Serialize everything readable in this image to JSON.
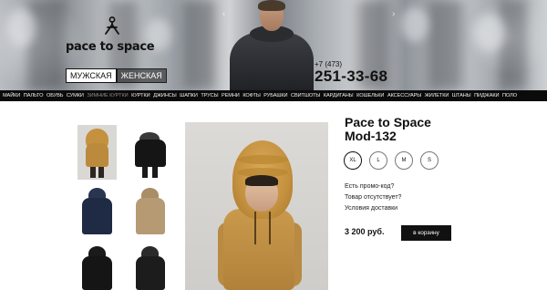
{
  "header": {
    "logo_text": "pace to space",
    "gender_tabs": [
      {
        "label": "МУЖСКАЯ",
        "active": true
      },
      {
        "label": "ЖЕНСКАЯ",
        "active": false
      }
    ],
    "phone_code": "+7 (473)",
    "phone_number": "251-33-68"
  },
  "nav": {
    "items": [
      {
        "label": "МАЙКИ",
        "active": false
      },
      {
        "label": "ПАЛЬТО",
        "active": false
      },
      {
        "label": "ОБУВЬ",
        "active": false
      },
      {
        "label": "СУМКИ",
        "active": false
      },
      {
        "label": "ЗИМНИЕ КУРТКИ",
        "active": true
      },
      {
        "label": "КУРТКИ",
        "active": false
      },
      {
        "label": "ДЖИНСЫ",
        "active": false
      },
      {
        "label": "ШАПКИ",
        "active": false
      },
      {
        "label": "ТРУСЫ",
        "active": false
      },
      {
        "label": "РЕМНИ",
        "active": false
      },
      {
        "label": "КОФТЫ",
        "active": false
      },
      {
        "label": "РУБАШКИ",
        "active": false
      },
      {
        "label": "СВИТШОТЫ",
        "active": false
      },
      {
        "label": "КАРДИГАНЫ",
        "active": false
      },
      {
        "label": "КОШЕЛЬКИ",
        "active": false
      },
      {
        "label": "АКСЕССУАРЫ",
        "active": false
      },
      {
        "label": "ЖИЛЕТКИ",
        "active": false
      },
      {
        "label": "ШТАНЫ",
        "active": false
      },
      {
        "label": "ПИДЖАКИ",
        "active": false
      },
      {
        "label": "ПОЛО",
        "active": false
      }
    ]
  },
  "product": {
    "brand": "Pace to Space",
    "model": "Mod-132",
    "sizes": [
      {
        "label": "XL",
        "selected": true
      },
      {
        "label": "L",
        "selected": false
      },
      {
        "label": "M",
        "selected": false
      },
      {
        "label": "S",
        "selected": false
      }
    ],
    "links": [
      "Есть промо-код?",
      "Товар отсутствует?",
      "Условия доставки"
    ],
    "price": "3 200 руб.",
    "cart_label": "в корзину"
  },
  "colors": {
    "nav_bg": "#0b0b0b",
    "cart_bg": "#111111",
    "jacket_mustard": "#c4913f",
    "jacket_navy": "#1f2a44",
    "jacket_khaki": "#b59a73",
    "jacket_black": "#151515"
  },
  "icons": [
    "hanger-icon",
    "arrow-left-icon",
    "arrow-right-icon"
  ]
}
